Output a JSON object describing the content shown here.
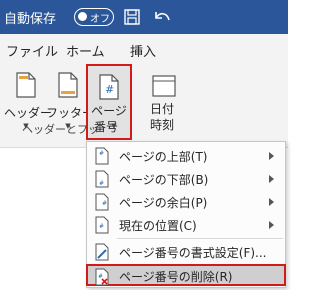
{
  "titlebar": {
    "autosave_label": "自動保存",
    "autosave_toggle": "オフ",
    "icons": [
      "save-icon",
      "undo-icon"
    ]
  },
  "tabs": [
    "ファイル",
    "ホーム",
    "挿入"
  ],
  "ribbon": {
    "buttons": [
      {
        "label": "ヘッダー",
        "icon": "header-icon"
      },
      {
        "label": "フッター",
        "icon": "footer-icon"
      },
      {
        "label_line1": "ページ",
        "label_line2": "番号",
        "icon": "page-number-icon"
      },
      {
        "label_line1": "日付",
        "label_line2": "時刻",
        "icon": "date-time-icon"
      }
    ],
    "group_label": "ヘッダーとフッ"
  },
  "menu": {
    "items": [
      {
        "label": "ページの上部(T)",
        "submenu": true
      },
      {
        "label": "ページの下部(B)",
        "submenu": true
      },
      {
        "label": "ページの余白(P)",
        "submenu": true
      },
      {
        "label": "現在の位置(C)",
        "submenu": true
      },
      {
        "label": "ページ番号の書式設定(F)...",
        "submenu": false
      },
      {
        "label": "ページ番号の削除(R)",
        "submenu": false
      }
    ]
  },
  "colors": {
    "titlebar": "#2b579a",
    "highlight": "#d11a1a",
    "ribbon": "#f3f3f3"
  }
}
